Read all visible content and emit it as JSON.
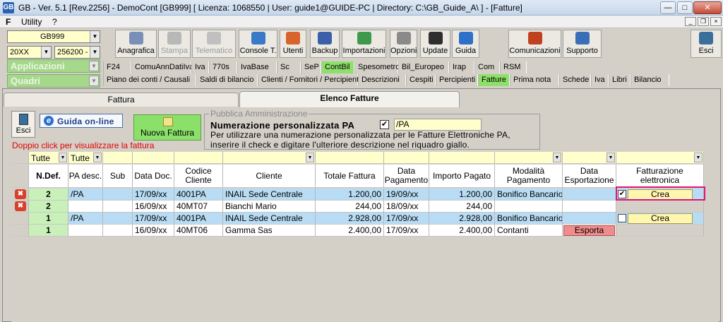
{
  "window": {
    "title": "GB - Ver. 5.1 [Rev.2256] - DemoCont [GB999]    [ Licenza: 1068550 | User: guide1@GUIDE-PC | Directory: C:\\GB_Guide_A\\ ] - [Fatture]",
    "app_badge": "GB"
  },
  "menu": {
    "brand": "F",
    "items": [
      "Utility",
      "?"
    ]
  },
  "selectors": {
    "company": "GB999",
    "year": "20XX",
    "code": "256200 -",
    "applicazioni": "Applicazioni",
    "quadri": "Quadri"
  },
  "toolbar": [
    {
      "label": "Anagrafica",
      "icon": "address-book-icon",
      "color": "#7a8fb8",
      "enabled": true
    },
    {
      "label": "Stampa",
      "icon": "printer-icon",
      "color": "#b8b8b8",
      "enabled": false
    },
    {
      "label": "Telematico",
      "icon": "telematico-icon",
      "color": "#c0c0c0",
      "enabled": false
    },
    {
      "label": "Console T.",
      "icon": "console-icon",
      "color": "#3a78c8",
      "enabled": true
    },
    {
      "label": "Utenti",
      "icon": "users-icon",
      "color": "#d8632b",
      "enabled": true
    },
    {
      "label": "Backup",
      "icon": "backup-icon",
      "color": "#3b5fa8",
      "enabled": true
    },
    {
      "label": "Importazioni",
      "icon": "import-icon",
      "color": "#3e9a4a",
      "enabled": true
    },
    {
      "label": "Opzioni",
      "icon": "tools-icon",
      "color": "#8a8a8a",
      "enabled": true
    },
    {
      "label": "Update",
      "icon": "monitor-icon",
      "color": "#2e2e2e",
      "enabled": true
    },
    {
      "label": "Guida",
      "icon": "help-icon",
      "color": "#2e6fc8",
      "enabled": true
    },
    {
      "label": "Comunicazioni",
      "icon": "communications-icon",
      "color": "#c04020",
      "enabled": true
    },
    {
      "label": "Supporto",
      "icon": "support-icon",
      "color": "#3a6fb8",
      "enabled": true
    },
    {
      "label": "Esci",
      "icon": "exit-icon",
      "color": "#3a6f9a",
      "enabled": true
    }
  ],
  "tabs_row1": [
    "F24",
    "ComuAnnDatiIva",
    "Iva",
    "770s",
    "IvaBase",
    "Sc",
    "SeP",
    "ContBil",
    "Spesometro",
    "Bil_Europeo",
    "Irap",
    "Com",
    "RSM"
  ],
  "tabs_row1_selected": "ContBil",
  "tabs_row2": [
    "Piano dei conti / Causali",
    "Saldi di bilancio",
    "Clienti / Fornitori / Percipienti",
    "Descrizioni",
    "Cespiti",
    "Percipienti",
    "Fatture",
    "Prima nota",
    "Schede",
    "Iva",
    "Libri",
    "Bilancio"
  ],
  "tabs_row2_selected": "Fatture",
  "panel_tabs": [
    "Fattura",
    "Elenco Fatture"
  ],
  "panel_tab_selected": "Elenco Fatture",
  "actions": {
    "esci": "Esci",
    "guida": "Guida on-line",
    "hint": "Doppio click per visualizzare la fattura",
    "nuova": "Nuova Fattura"
  },
  "pa": {
    "legend": "Pubblica Amministrazione",
    "heading": "Numerazione personalizzata PA",
    "checked": true,
    "value": "/PA",
    "desc1": "Per utilizzare una numerazione personalizzata per le Fatture Elettroniche PA,",
    "desc2": "inserire il check e digitare l'ulteriore descrizione nel riquadro giallo."
  },
  "filters": [
    "Tutte",
    "Tutte"
  ],
  "columns": [
    "N.Def.",
    "PA desc.",
    "Sub",
    "Data Doc.",
    "Codice Cliente",
    "Cliente",
    "Totale Fattura",
    "Data Pagamento",
    "Importo Pagato",
    "Modalità Pagamento",
    "Data Esportazione",
    "Fatturazione elettronica"
  ],
  "rows": [
    {
      "del": true,
      "ndef": "2",
      "pa": "/PA",
      "sub": "",
      "data": "17/09/xx",
      "cod": "4001PA",
      "cliente": "INAIL Sede Centrale",
      "tot": "1.200,00",
      "dpag": "19/09/xx",
      "imp": "1.200,00",
      "mod": "Bonifico Bancario",
      "dexp": "",
      "chk": true,
      "action": "Crea",
      "style": "blue"
    },
    {
      "del": true,
      "ndef": "2",
      "pa": "",
      "sub": "",
      "data": "16/09/xx",
      "cod": "40MT07",
      "cliente": "Bianchi Mario",
      "tot": "244,00",
      "dpag": "18/09/xx",
      "imp": "244,00",
      "mod": "",
      "dexp": "",
      "chk": false,
      "action": "",
      "style": "white"
    },
    {
      "del": false,
      "ndef": "1",
      "pa": "/PA",
      "sub": "",
      "data": "17/09/xx",
      "cod": "4001PA",
      "cliente": "INAIL Sede Centrale",
      "tot": "2.928,00",
      "dpag": "17/09/xx",
      "imp": "2.928,00",
      "mod": "Bonifico Bancario",
      "dexp": "",
      "chk": false,
      "action": "Crea",
      "style": "blue"
    },
    {
      "del": false,
      "ndef": "1",
      "pa": "",
      "sub": "",
      "data": "16/09/xx",
      "cod": "40MT06",
      "cliente": "Gamma Sas",
      "tot": "2.400,00",
      "dpag": "17/09/xx",
      "imp": "2.400,00",
      "mod": "Contanti",
      "dexp": "Esporta",
      "chk": false,
      "action": "",
      "style": "white"
    }
  ]
}
